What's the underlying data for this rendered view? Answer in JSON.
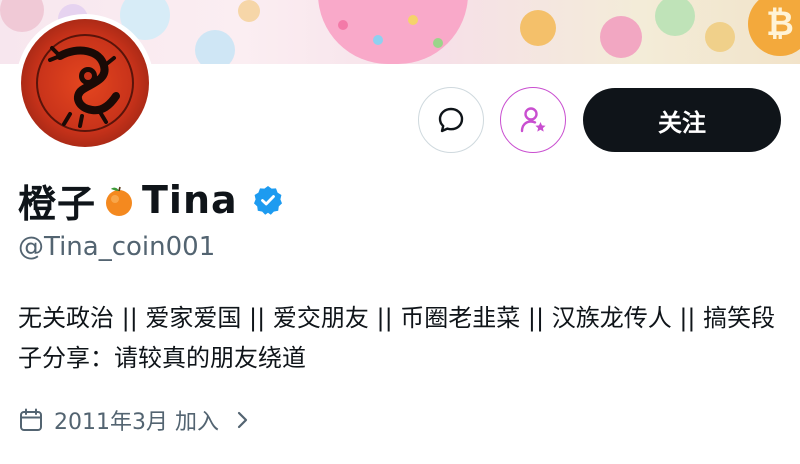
{
  "profile": {
    "display_name_prefix": "橙子",
    "display_name_suffix": "Tina",
    "name_emoji": "orange-emoji",
    "verified_icon": "verified-badge-icon",
    "handle": "@Tina_coin001",
    "bio": "无关政治 || 爱家爱国 || 爱交朋友 || 币圈老韭菜 || 汉族龙传人 || 搞笑段子分享：请较真的朋友绕道",
    "joined": "2011年3月 加入"
  },
  "actions": {
    "message_icon": "message-bubble-icon",
    "subscribe_icon": "person-star-icon",
    "follow_label": "关注"
  },
  "banner": {
    "coin_symbol": "₿"
  },
  "colors": {
    "follow_button_bg": "#0f1419",
    "verified_blue": "#1d9bf0",
    "subscribe_accent": "#c94fd0",
    "secondary_text": "#536471"
  }
}
